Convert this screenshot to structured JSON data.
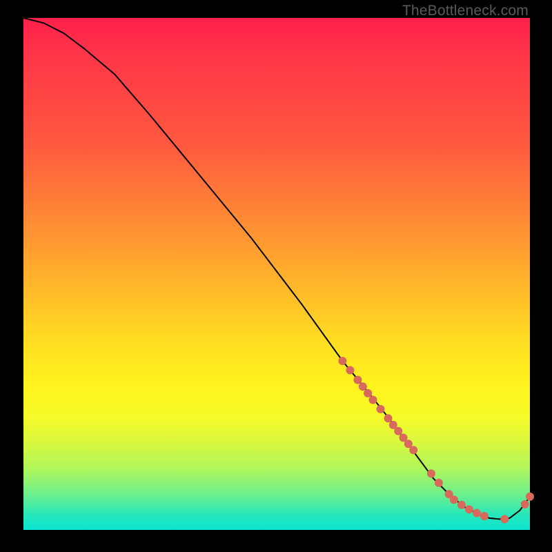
{
  "watermark": "TheBottleneck.com",
  "chart_data": {
    "type": "line",
    "title": "",
    "xlabel": "",
    "ylabel": "",
    "xlim": [
      0,
      100
    ],
    "ylim": [
      0,
      100
    ],
    "series": [
      {
        "name": "curve",
        "x": [
          0,
          4,
          8,
          12,
          18,
          25,
          35,
          45,
          55,
          63,
          68,
          72,
          75,
          78,
          81,
          84,
          87,
          90,
          92,
          94,
          96,
          98,
          100
        ],
        "y": [
          100,
          99,
          97,
          94,
          89,
          81,
          69,
          57,
          44,
          33,
          27,
          22,
          18,
          14,
          10,
          7,
          4.5,
          3,
          2.3,
          2.1,
          2.3,
          3.8,
          6.5
        ]
      }
    ],
    "markers": {
      "name": "highlight-points",
      "x": [
        63,
        64.5,
        66,
        67,
        68,
        69,
        70.5,
        72,
        73,
        74,
        75,
        76,
        77,
        80.5,
        82,
        84,
        85,
        86.5,
        88,
        89.5,
        91,
        95,
        99,
        100
      ],
      "y": [
        33,
        31.2,
        29.3,
        28,
        26.7,
        25.4,
        23.6,
        21.8,
        20.5,
        19.3,
        18,
        16.8,
        15.6,
        11,
        9.2,
        7,
        5.9,
        4.9,
        4,
        3.3,
        2.7,
        2.1,
        5,
        6.5
      ]
    }
  }
}
